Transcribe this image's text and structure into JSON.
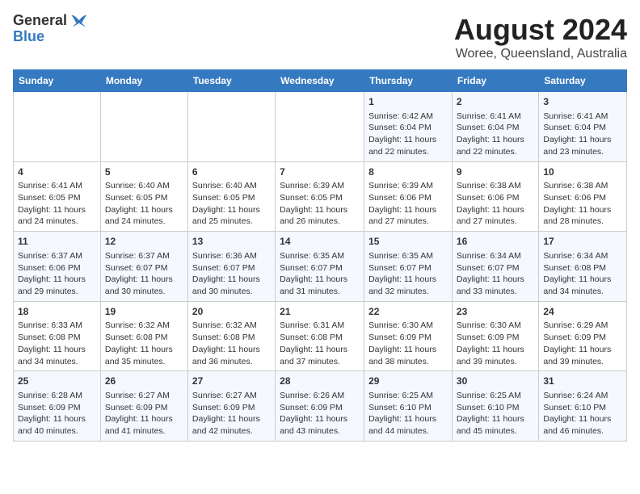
{
  "header": {
    "logo_general": "General",
    "logo_blue": "Blue",
    "main_title": "August 2024",
    "subtitle": "Woree, Queensland, Australia"
  },
  "days_of_week": [
    "Sunday",
    "Monday",
    "Tuesday",
    "Wednesday",
    "Thursday",
    "Friday",
    "Saturday"
  ],
  "weeks": [
    [
      {
        "day": "",
        "empty": true
      },
      {
        "day": "",
        "empty": true
      },
      {
        "day": "",
        "empty": true
      },
      {
        "day": "",
        "empty": true
      },
      {
        "day": "1",
        "sunrise": "6:42 AM",
        "sunset": "6:04 PM",
        "daylight": "11 hours and 22 minutes."
      },
      {
        "day": "2",
        "sunrise": "6:41 AM",
        "sunset": "6:04 PM",
        "daylight": "11 hours and 22 minutes."
      },
      {
        "day": "3",
        "sunrise": "6:41 AM",
        "sunset": "6:04 PM",
        "daylight": "11 hours and 23 minutes."
      }
    ],
    [
      {
        "day": "4",
        "sunrise": "6:41 AM",
        "sunset": "6:05 PM",
        "daylight": "11 hours and 24 minutes."
      },
      {
        "day": "5",
        "sunrise": "6:40 AM",
        "sunset": "6:05 PM",
        "daylight": "11 hours and 24 minutes."
      },
      {
        "day": "6",
        "sunrise": "6:40 AM",
        "sunset": "6:05 PM",
        "daylight": "11 hours and 25 minutes."
      },
      {
        "day": "7",
        "sunrise": "6:39 AM",
        "sunset": "6:05 PM",
        "daylight": "11 hours and 26 minutes."
      },
      {
        "day": "8",
        "sunrise": "6:39 AM",
        "sunset": "6:06 PM",
        "daylight": "11 hours and 27 minutes."
      },
      {
        "day": "9",
        "sunrise": "6:38 AM",
        "sunset": "6:06 PM",
        "daylight": "11 hours and 27 minutes."
      },
      {
        "day": "10",
        "sunrise": "6:38 AM",
        "sunset": "6:06 PM",
        "daylight": "11 hours and 28 minutes."
      }
    ],
    [
      {
        "day": "11",
        "sunrise": "6:37 AM",
        "sunset": "6:06 PM",
        "daylight": "11 hours and 29 minutes."
      },
      {
        "day": "12",
        "sunrise": "6:37 AM",
        "sunset": "6:07 PM",
        "daylight": "11 hours and 30 minutes."
      },
      {
        "day": "13",
        "sunrise": "6:36 AM",
        "sunset": "6:07 PM",
        "daylight": "11 hours and 30 minutes."
      },
      {
        "day": "14",
        "sunrise": "6:35 AM",
        "sunset": "6:07 PM",
        "daylight": "11 hours and 31 minutes."
      },
      {
        "day": "15",
        "sunrise": "6:35 AM",
        "sunset": "6:07 PM",
        "daylight": "11 hours and 32 minutes."
      },
      {
        "day": "16",
        "sunrise": "6:34 AM",
        "sunset": "6:07 PM",
        "daylight": "11 hours and 33 minutes."
      },
      {
        "day": "17",
        "sunrise": "6:34 AM",
        "sunset": "6:08 PM",
        "daylight": "11 hours and 34 minutes."
      }
    ],
    [
      {
        "day": "18",
        "sunrise": "6:33 AM",
        "sunset": "6:08 PM",
        "daylight": "11 hours and 34 minutes."
      },
      {
        "day": "19",
        "sunrise": "6:32 AM",
        "sunset": "6:08 PM",
        "daylight": "11 hours and 35 minutes."
      },
      {
        "day": "20",
        "sunrise": "6:32 AM",
        "sunset": "6:08 PM",
        "daylight": "11 hours and 36 minutes."
      },
      {
        "day": "21",
        "sunrise": "6:31 AM",
        "sunset": "6:08 PM",
        "daylight": "11 hours and 37 minutes."
      },
      {
        "day": "22",
        "sunrise": "6:30 AM",
        "sunset": "6:09 PM",
        "daylight": "11 hours and 38 minutes."
      },
      {
        "day": "23",
        "sunrise": "6:30 AM",
        "sunset": "6:09 PM",
        "daylight": "11 hours and 39 minutes."
      },
      {
        "day": "24",
        "sunrise": "6:29 AM",
        "sunset": "6:09 PM",
        "daylight": "11 hours and 39 minutes."
      }
    ],
    [
      {
        "day": "25",
        "sunrise": "6:28 AM",
        "sunset": "6:09 PM",
        "daylight": "11 hours and 40 minutes."
      },
      {
        "day": "26",
        "sunrise": "6:27 AM",
        "sunset": "6:09 PM",
        "daylight": "11 hours and 41 minutes."
      },
      {
        "day": "27",
        "sunrise": "6:27 AM",
        "sunset": "6:09 PM",
        "daylight": "11 hours and 42 minutes."
      },
      {
        "day": "28",
        "sunrise": "6:26 AM",
        "sunset": "6:09 PM",
        "daylight": "11 hours and 43 minutes."
      },
      {
        "day": "29",
        "sunrise": "6:25 AM",
        "sunset": "6:10 PM",
        "daylight": "11 hours and 44 minutes."
      },
      {
        "day": "30",
        "sunrise": "6:25 AM",
        "sunset": "6:10 PM",
        "daylight": "11 hours and 45 minutes."
      },
      {
        "day": "31",
        "sunrise": "6:24 AM",
        "sunset": "6:10 PM",
        "daylight": "11 hours and 46 minutes."
      }
    ]
  ],
  "labels": {
    "sunrise_prefix": "Sunrise: ",
    "sunset_prefix": "Sunset: ",
    "daylight_prefix": "Daylight: "
  }
}
